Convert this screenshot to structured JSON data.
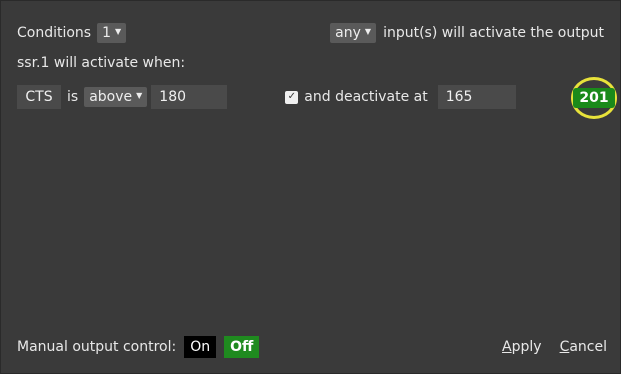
{
  "header": {
    "conditions_label": "Conditions",
    "conditions_count": "1",
    "mode": "any",
    "activate_suffix": "input(s) will activate the output"
  },
  "when_label": "ssr.1 will activate when:",
  "condition": {
    "input": "CTS",
    "is": "is",
    "comparison": "above",
    "threshold": "180",
    "deactivate_checked": true,
    "deactivate_label": "and deactivate at",
    "deactivate_value": "165",
    "current_value": "201"
  },
  "footer": {
    "manual_label": "Manual output control:",
    "on_label": "On",
    "off_label": "Off",
    "apply_first": "A",
    "apply_rest": "pply",
    "cancel_first": "C",
    "cancel_rest": "ancel"
  },
  "colors": {
    "background": "#3a3a3a",
    "active_green": "#1f8a1f",
    "highlight_ring": "#e8e23a"
  }
}
